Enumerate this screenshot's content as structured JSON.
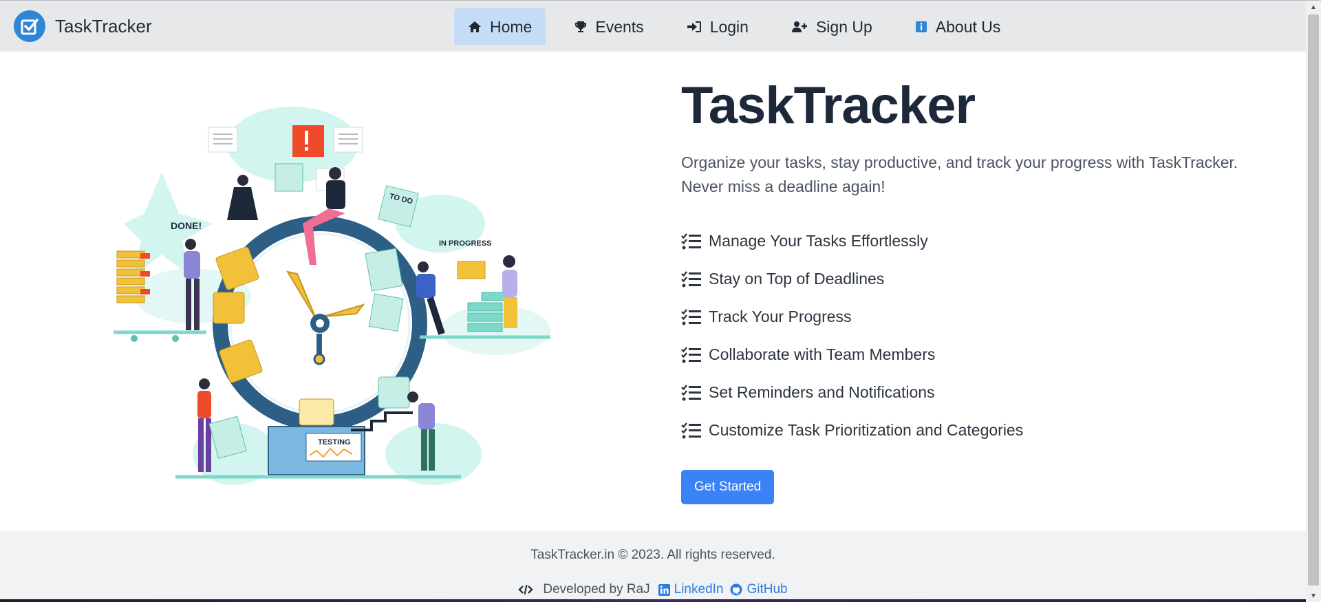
{
  "brand": {
    "name": "TaskTracker",
    "accent": "#2f86d6"
  },
  "nav": {
    "items": [
      {
        "label": "Home",
        "icon": "home-icon",
        "active": true
      },
      {
        "label": "Events",
        "icon": "trophy-icon",
        "active": false
      },
      {
        "label": "Login",
        "icon": "login-icon",
        "active": false
      },
      {
        "label": "Sign Up",
        "icon": "user-plus-icon",
        "active": false
      },
      {
        "label": "About Us",
        "icon": "info-icon",
        "active": false
      }
    ]
  },
  "illustration": {
    "labels": {
      "done": "DONE!",
      "todo": "TO DO",
      "in_progress": "IN PROGRESS",
      "testing": "TESTING"
    }
  },
  "hero": {
    "title": "TaskTracker",
    "description": "Organize your tasks, stay productive, and track your progress with TaskTracker. Never miss a deadline again!",
    "features": [
      "Manage Your Tasks Effortlessly",
      "Stay on Top of Deadlines",
      "Track Your Progress",
      "Collaborate with Team Members",
      "Set Reminders and Notifications",
      "Customize Task Prioritization and Categories"
    ],
    "cta_label": "Get Started",
    "cta_color": "#3b82f6"
  },
  "footer": {
    "copyright": "TaskTracker.in © 2023. All rights reserved.",
    "developed_by": "Developed by RaJ",
    "linkedin_label": "LinkedIn",
    "github_label": "GitHub"
  }
}
